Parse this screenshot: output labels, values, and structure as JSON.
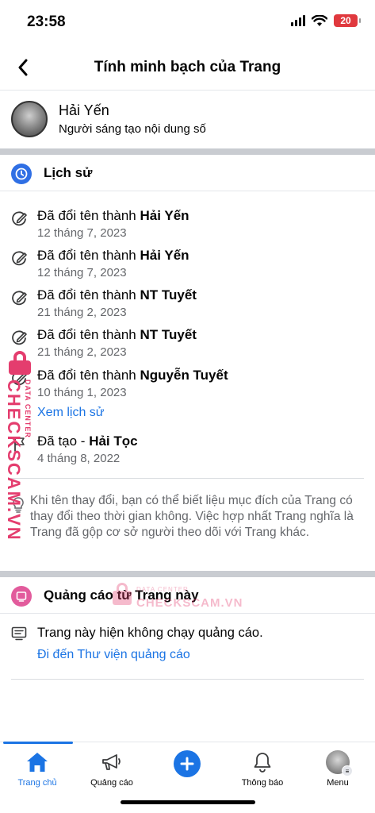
{
  "status_bar": {
    "time": "23:58",
    "battery": "20"
  },
  "header": {
    "title": "Tính minh bạch của Trang"
  },
  "profile": {
    "name": "Hải Yến",
    "subtitle": "Người sáng tạo nội dung số"
  },
  "history": {
    "title": "Lịch sử",
    "items": [
      {
        "prefix": "Đã đổi tên thành ",
        "name": "Hải Yến",
        "date": "12 tháng 7, 2023",
        "icon": "rename-icon"
      },
      {
        "prefix": "Đã đổi tên thành ",
        "name": "Hải Yến",
        "date": "12 tháng 7, 2023",
        "icon": "rename-icon"
      },
      {
        "prefix": "Đã đổi tên thành ",
        "name": "NT Tuyết",
        "date": "21 tháng 2, 2023",
        "icon": "rename-icon"
      },
      {
        "prefix": "Đã đổi tên thành ",
        "name": "NT Tuyết",
        "date": "21 tháng 2, 2023",
        "icon": "rename-icon"
      },
      {
        "prefix": "Đã đổi tên thành ",
        "name": "Nguyễn Tuyết",
        "date": "10 tháng 1, 2023",
        "icon": "rename-icon"
      }
    ],
    "view_history_link": "Xem lịch sử",
    "created": {
      "prefix": "Đã tạo - ",
      "name": "Hải Tọc",
      "date": "4 tháng 8, 2022",
      "icon": "flag-icon"
    },
    "info": "Khi tên thay đổi, bạn có thể biết liệu mục đích của Trang có thay đổi theo thời gian không. Việc hợp nhất Trang nghĩa là Trang đã gộp cơ sở người theo dõi với Trang khác."
  },
  "ads": {
    "title": "Quảng cáo từ Trang này",
    "status": "Trang này hiện không chạy quảng cáo.",
    "library_link": "Đi đến Thư viện quảng cáo"
  },
  "watermark": {
    "brand": "CHECKSCAM.VN",
    "tagline": "DATA CENTER"
  },
  "tabs": [
    {
      "label": "Trang chủ",
      "icon": "home-icon",
      "active": true
    },
    {
      "label": "Quảng cáo",
      "icon": "megaphone-icon",
      "active": false
    },
    {
      "label": "",
      "icon": "plus-icon",
      "active": false
    },
    {
      "label": "Thông báo",
      "icon": "bell-icon",
      "active": false
    },
    {
      "label": "Menu",
      "icon": "avatar-icon",
      "active": false
    }
  ],
  "colors": {
    "accent": "#1b74e4",
    "history_icon_bg": "#2f6fe4",
    "ads_icon_bg": "#e25b9c",
    "watermark": "#e43d6e"
  }
}
